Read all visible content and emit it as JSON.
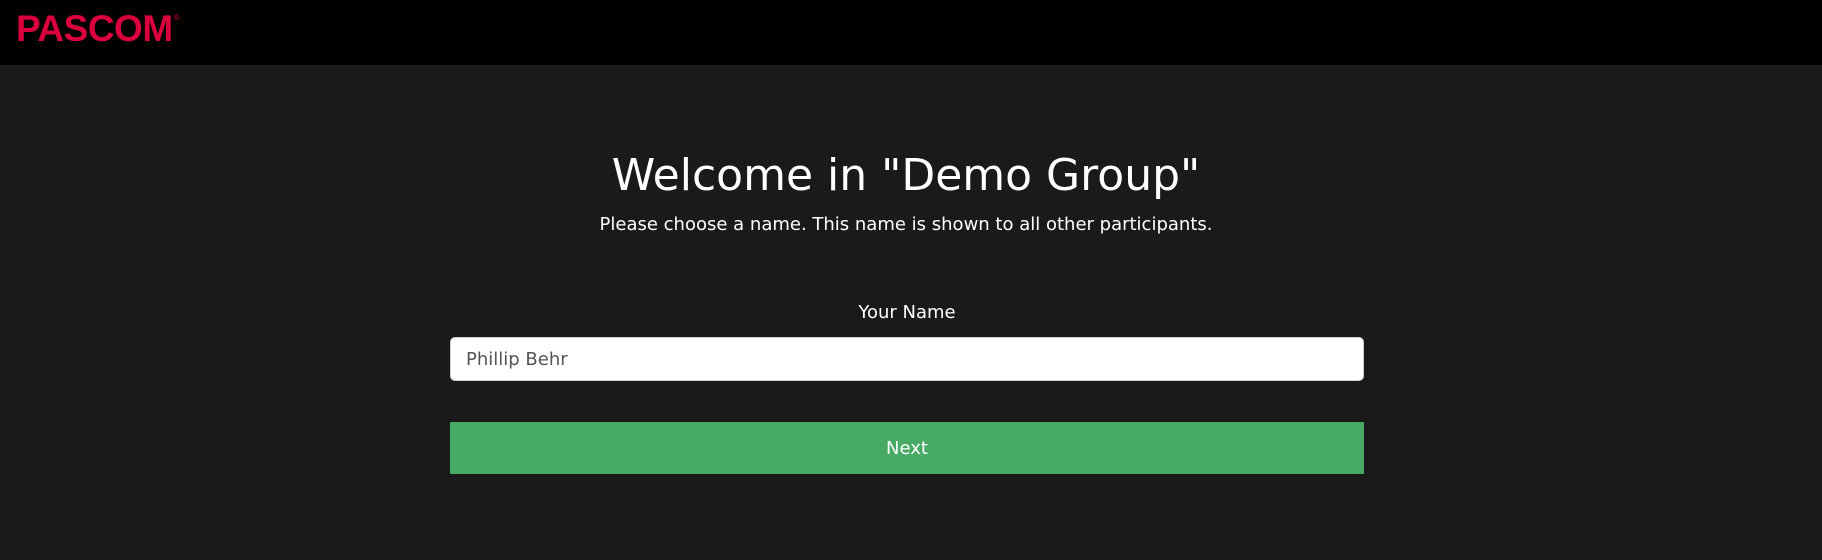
{
  "header": {
    "logo_text": "PASCOM",
    "logo_mark": "®",
    "brand_color": "#d9003d"
  },
  "main": {
    "title": "Welcome in \"Demo Group\"",
    "subtitle": "Please choose a name. This name is shown to all other participants.",
    "name_field": {
      "label": "Your Name",
      "value": "Phillip Behr",
      "placeholder": ""
    },
    "next_button_label": "Next",
    "button_color": "#46aa64"
  }
}
